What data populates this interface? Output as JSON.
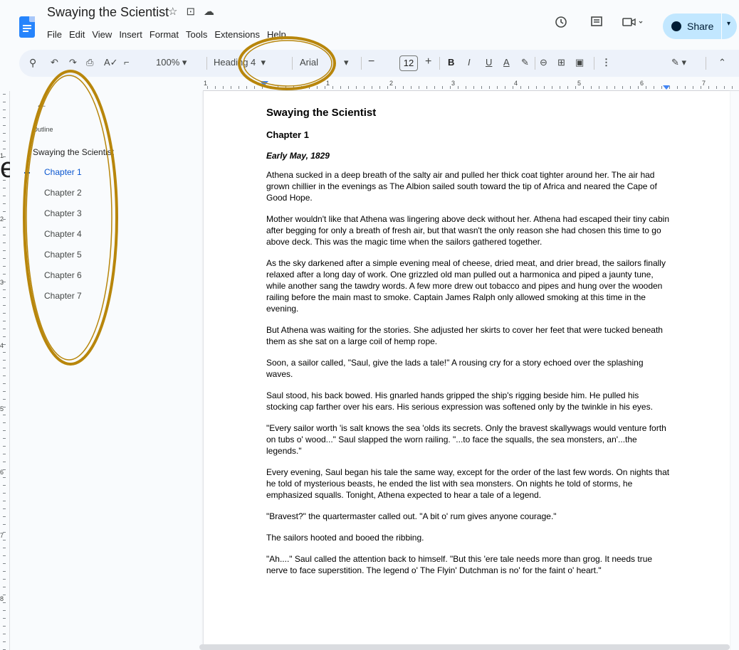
{
  "app": {
    "doc_title": "Swaying the Scientist",
    "menu": [
      "File",
      "Edit",
      "View",
      "Insert",
      "Format",
      "Tools",
      "Extensions",
      "Help"
    ],
    "share_label": "Share",
    "icons": {
      "title": [
        "star-icon",
        "folder-icon",
        "cloud-icon"
      ],
      "right": [
        "history-icon",
        "comment-icon",
        "video-call-icon"
      ]
    }
  },
  "toolbar": {
    "zoom": "100%",
    "style": "Heading 4",
    "font": "Arial",
    "font_size": "12",
    "bold": "B",
    "italic": "I",
    "underline": "U",
    "text_color": "A",
    "minus": "−",
    "plus": "+"
  },
  "ruler": {
    "h_numbers": [
      "1",
      "1",
      "2",
      "3",
      "4",
      "5",
      "6",
      "7"
    ],
    "v_numbers": [
      "1",
      "2",
      "3",
      "4",
      "5",
      "6",
      "7",
      "8"
    ]
  },
  "outline": {
    "label": "Outline",
    "title": "Swaying the Scientist",
    "items": [
      "Chapter 1",
      "Chapter 2",
      "Chapter 3",
      "Chapter 4",
      "Chapter 5",
      "Chapter 6",
      "Chapter 7"
    ],
    "active_index": 0
  },
  "document": {
    "title": "Swaying the Scientist",
    "chapter": "Chapter 1",
    "date": "Early May, 1829",
    "paragraphs": [
      "Athena sucked in a deep breath of the salty air and pulled her thick coat tighter around her. The air had grown chillier in the evenings as The Albion sailed south toward the tip of Africa and neared the Cape of Good Hope.",
      "Mother wouldn't like that Athena was lingering above deck without her. Athena had escaped their tiny cabin after begging for only a breath of fresh air, but that wasn't the only reason she had chosen this time to go above deck. This was the magic time when the sailors gathered together.",
      "As the sky darkened after a simple evening meal of cheese, dried meat, and drier bread, the sailors finally relaxed after a long day of work. One grizzled old man pulled out a harmonica and piped a jaunty tune, while another sang the tawdry words. A few more drew out tobacco and pipes and hung over the wooden railing before the main mast to smoke. Captain James Ralph only allowed smoking at this time in the evening.",
      "But Athena was waiting for the stories. She adjusted her skirts to cover her feet that were tucked beneath them as she sat on a large coil of hemp rope.",
      "Soon, a sailor called, \"Saul, give the lads a tale!\" A rousing cry for a story echoed over the splashing waves.",
      "Saul stood, his back bowed. His gnarled hands gripped the ship's rigging beside him. He pulled his stocking cap farther over his ears. His serious expression was softened only by the twinkle in his eyes.",
      "\"Every sailor worth 'is salt knows the sea 'olds its secrets. Only the bravest skallywags would venture forth on tubs o' wood...\" Saul slapped the worn railing. \"...to face the squalls, the sea monsters, an'...the legends.\"",
      "Every evening, Saul began his tale the same way, except for the order of the last few words. On nights that he told of mysterious beasts, he ended the list with sea monsters. On nights he told of storms, he emphasized squalls. Tonight, Athena expected to hear a tale of a legend.",
      "\"Bravest?\" the quartermaster called out. \"A bit o' rum gives anyone courage.\"",
      "The sailors hooted and booed the ribbing.",
      "\"Ah....\" Saul called the attention back to himself. \"But this 'ere tale needs more than grog. It needs true nerve to face superstition. The legend o' The Flyin' Dutchman is no' for the faint o' heart.\""
    ]
  },
  "colors": {
    "accent": "#0b57d0",
    "share_bg": "#c2e7ff",
    "annotation": "#b8860b",
    "toolbar_bg": "#edf2fa"
  },
  "stray_glyph": "e"
}
